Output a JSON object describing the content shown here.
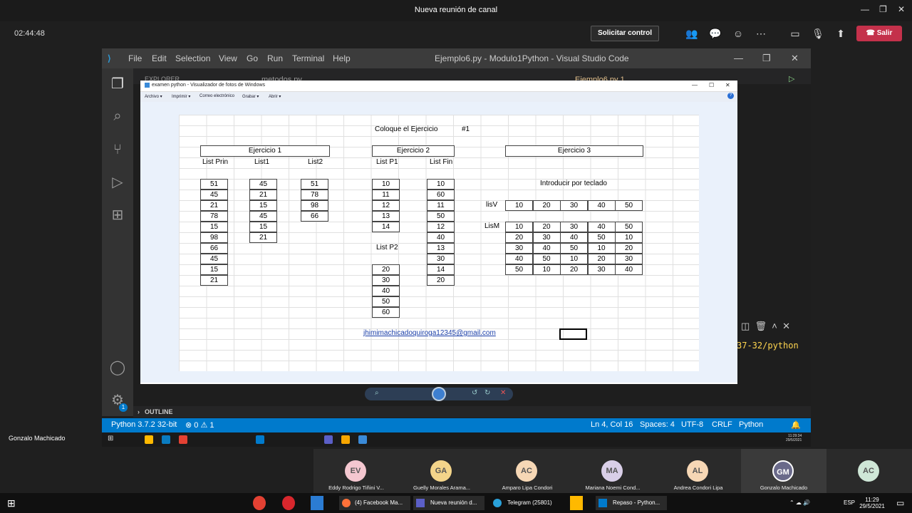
{
  "teams": {
    "title": "Nueva reunión de canal",
    "timer": "02:44:48",
    "control_label": "Solicitar control",
    "leave_label": "Salir",
    "presenter": "Gonzalo Machicado"
  },
  "vscode": {
    "menu": [
      "File",
      "Edit",
      "Selection",
      "View",
      "Go",
      "Run",
      "Terminal",
      "Help"
    ],
    "title": "Ejemplo6.py - Modulo1Python - Visual Studio Code",
    "explorer": "EXPLORER",
    "tab1": "metodos.py",
    "tab2": "Ejemplo6.py 1",
    "outline": "OUTLINE",
    "terminal_path": "37-32/python",
    "status": {
      "python": "Python 3.7.2 32-bit",
      "problems": "⊗ 0 ⚠ 1",
      "cursor": "Ln 4, Col 16",
      "spaces": "Spaces: 4",
      "encoding": "UTF-8",
      "eol": "CRLF",
      "lang": "Python"
    },
    "settings_badge": "1"
  },
  "viewer": {
    "title": "examen python - Visualizador de fotos de Windows",
    "menu": [
      "Archivo ▾",
      "Imprimir ▾",
      "Correo electrónico",
      "Grabar ▾",
      "Abrir ▾"
    ]
  },
  "sheet": {
    "heading": "Coloque el Ejercicio",
    "heading_num": "#1",
    "ej1": {
      "title": "Ejercicio 1",
      "h_prin": "List Prin",
      "h_l1": "List1",
      "h_l2": "List2",
      "prin": [
        "51",
        "45",
        "21",
        "78",
        "15",
        "98",
        "66",
        "45",
        "15",
        "21"
      ],
      "list1": [
        "45",
        "21",
        "15",
        "45",
        "15",
        "21"
      ],
      "list2": [
        "51",
        "78",
        "98",
        "66"
      ]
    },
    "ej2": {
      "title": "Ejercicio 2",
      "h_p1": "List P1",
      "h_fin": "List Fin",
      "h_p2": "List P2",
      "p1": [
        "10",
        "11",
        "12",
        "13",
        "14"
      ],
      "fin": [
        "10",
        "60",
        "11",
        "50",
        "12",
        "40",
        "13",
        "30",
        "14",
        "20"
      ],
      "p2": [
        "20",
        "30",
        "40",
        "50",
        "60"
      ]
    },
    "ej3": {
      "title": "Ejercicio 3",
      "sub": "Introducir por teclado",
      "lisv_label": "lisV",
      "lism_label": "LisM",
      "lisv": [
        "10",
        "20",
        "30",
        "40",
        "50"
      ],
      "lism": [
        [
          "10",
          "20",
          "30",
          "40",
          "50"
        ],
        [
          "20",
          "30",
          "40",
          "50",
          "10"
        ],
        [
          "30",
          "40",
          "50",
          "10",
          "20"
        ],
        [
          "40",
          "50",
          "10",
          "20",
          "30"
        ],
        [
          "50",
          "10",
          "20",
          "30",
          "40"
        ]
      ]
    },
    "email": "jhimimachicadoquiroga12345@gmail.com"
  },
  "inner_clock": {
    "time": "11:29:34",
    "date": "29/5/2021"
  },
  "participants": [
    {
      "initials": "EV",
      "name": "Eddy Rodrigo Tiñini V...",
      "color": "#f4c7d0"
    },
    {
      "initials": "GA",
      "name": "Guelly Morales Arama...",
      "color": "#f3d48a"
    },
    {
      "initials": "AC",
      "name": "Amparo Lipa Condori",
      "color": "#f6d7b5"
    },
    {
      "initials": "MA",
      "name": "Mariana Noemi Cond...",
      "color": "#d9cfe8"
    },
    {
      "initials": "AL",
      "name": "Andrea Condori Lipa",
      "color": "#f6d7b5"
    },
    {
      "initials": "GM",
      "name": "Gonzalo Machicado",
      "color": "#c8d0e8"
    },
    {
      "initials": "AC",
      "name": "",
      "color": "#cfe7d7"
    }
  ],
  "taskbar": {
    "items": [
      "(4) Facebook Ma...",
      "Nueva reunión d...",
      "Telegram (25801)",
      "Repaso - Python..."
    ],
    "lang": "ESP",
    "time": "11:29",
    "date": "29/5/2021"
  }
}
